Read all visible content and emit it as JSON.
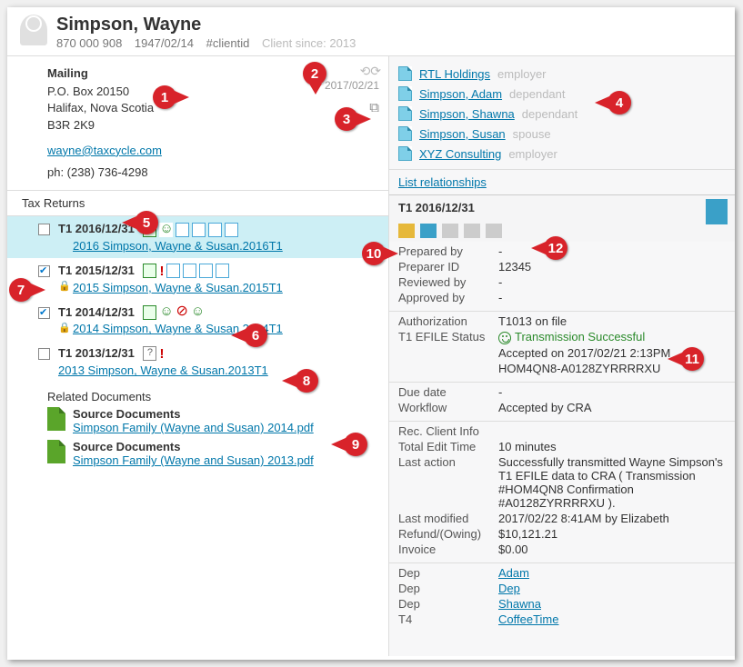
{
  "client": {
    "name": "Simpson, Wayne",
    "sin": "870 000 908",
    "birthdate": "1947/02/14",
    "clientid": "#clientid",
    "since_label": "Client since: 2013"
  },
  "contact": {
    "mailing_label": "Mailing",
    "line1": "P.O. Box 20150",
    "line2": "Halifax, Nova Scotia",
    "line3": "B3R 2K9",
    "email": "wayne@taxcycle.com",
    "phone": "ph: (238) 736-4298",
    "nav_date": "2017/02/21"
  },
  "tax_returns_label": "Tax Returns",
  "returns": [
    {
      "title": "T1 2016/12/31",
      "link": "2016 Simpson, Wayne & Susan.2016T1",
      "checked": false,
      "locked": false,
      "selected": true
    },
    {
      "title": "T1 2015/12/31",
      "link": "2015 Simpson, Wayne & Susan.2015T1",
      "checked": true,
      "locked": true,
      "selected": false
    },
    {
      "title": "T1 2014/12/31",
      "link": "2014 Simpson, Wayne & Susan.2014T1",
      "checked": true,
      "locked": true,
      "selected": false
    },
    {
      "title": "T1 2013/12/31",
      "link": "2013 Simpson, Wayne & Susan.2013T1",
      "checked": false,
      "locked": false,
      "selected": false
    }
  ],
  "related_docs_label": "Related Documents",
  "docs": [
    {
      "title": "Source Documents",
      "file": "Simpson Family (Wayne and Susan) 2014.pdf"
    },
    {
      "title": "Source Documents",
      "file": "Simpson Family (Wayne and Susan) 2013.pdf"
    }
  ],
  "relationships": [
    {
      "name": "RTL Holdings",
      "role": "employer"
    },
    {
      "name": "Simpson, Adam",
      "role": "dependant"
    },
    {
      "name": "Simpson, Shawna",
      "role": "dependant"
    },
    {
      "name": "Simpson, Susan",
      "role": "spouse"
    },
    {
      "name": "XYZ Consulting",
      "role": "employer"
    }
  ],
  "list_relationships_label": "List relationships",
  "detail": {
    "heading": "T1 2016/12/31",
    "prep": {
      "prepared_by_k": "Prepared by",
      "prepared_by_v": "-",
      "preparer_id_k": "Preparer ID",
      "preparer_id_v": "12345",
      "reviewed_by_k": "Reviewed by",
      "reviewed_by_v": "-",
      "approved_by_k": "Approved by",
      "approved_by_v": "-"
    },
    "auth": {
      "auth_k": "Authorization",
      "auth_v": "T1013 on file",
      "efile_k": "T1 EFILE Status",
      "efile_v": "Transmission Successful",
      "accepted": "Accepted on 2017/02/21 2:13PM",
      "conf": "HOM4QN8-A0128ZYRRRRXU"
    },
    "workflow": {
      "due_k": "Due date",
      "due_v": "-",
      "wf_k": "Workflow",
      "wf_v": "Accepted by CRA"
    },
    "rec_label": "Rec. Client Info",
    "rec": {
      "edit_k": "Total Edit Time",
      "edit_v": "10 minutes",
      "last_action_k": "Last action",
      "last_action_v": "Successfully transmitted Wayne Simpson's T1 EFILE data to CRA ( Transmission #HOM4QN8 Confirmation #A0128ZYRRRRXU ).",
      "last_mod_k": "Last modified",
      "last_mod_v": "2017/02/22 8:41AM by Elizabeth",
      "refund_k": "Refund/(Owing)",
      "refund_v": "$10,121.21",
      "invoice_k": "Invoice",
      "invoice_v": "$0.00"
    },
    "deps": [
      {
        "k": "Dep",
        "v": "Adam"
      },
      {
        "k": "Dep",
        "v": "Dep"
      },
      {
        "k": "Dep",
        "v": "Shawna"
      },
      {
        "k": "T4",
        "v": "CoffeeTime"
      }
    ]
  },
  "callouts": {
    "c1": "1",
    "c2": "2",
    "c3": "3",
    "c4": "4",
    "c5": "5",
    "c6": "6",
    "c7": "7",
    "c8": "8",
    "c9": "9",
    "c10": "10",
    "c11": "11",
    "c12": "12"
  }
}
